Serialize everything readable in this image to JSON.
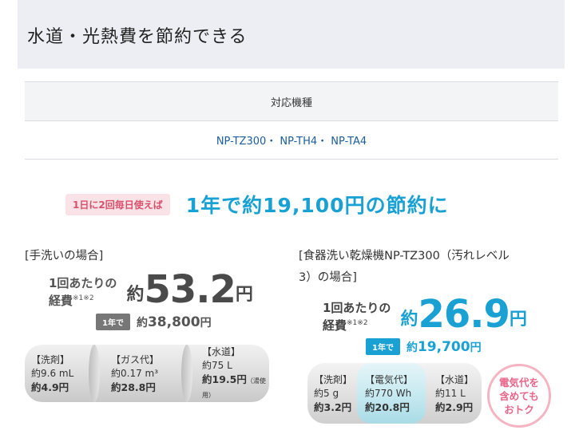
{
  "header": {
    "title": "水道・光熱費を節約できる"
  },
  "models": {
    "header": "対応機種",
    "value": "NP-TZ300・ NP-TH4・ NP-TA4"
  },
  "summary": {
    "tag": "1日に2回毎日使えば",
    "text": "1年で約19,100円の節約に"
  },
  "left": {
    "title": "[手洗いの場合]",
    "perrun_line1": "1回あたりの",
    "perrun_line2": "経費",
    "perrun_note": "※1※2",
    "yaku": "約",
    "amount": "53.2",
    "unit": "円",
    "year_badge": "1年で",
    "year_prefix": "約",
    "year_amount": "38,800",
    "year_unit": "円",
    "items": [
      {
        "label": "【洗剤】",
        "usage": "約9.6 mL",
        "cost": "約4.9円",
        "note": ""
      },
      {
        "label": "【ガス代】",
        "usage": "約0.17 m³",
        "cost": "約28.8円",
        "note": ""
      },
      {
        "label": "【水道】",
        "usage": "約75 L",
        "cost": "約19.5円",
        "note": "（湯使用）"
      }
    ]
  },
  "right": {
    "title_line1": "[食器洗い乾燥機NP-TZ300（汚れレベル",
    "title_line2": "3）の場合]",
    "perrun_line1": "1回あたりの",
    "perrun_line2": "経費",
    "perrun_note": "※1※2",
    "yaku": "約",
    "amount": "26.9",
    "unit": "円",
    "year_badge": "1年で",
    "year_prefix": "約",
    "year_amount": "19,700",
    "year_unit": "円",
    "items": [
      {
        "label": "【洗剤】",
        "usage": "約5 g",
        "cost": "約3.2円"
      },
      {
        "label": "【電気代】",
        "usage": "約770 Wh",
        "cost": "約20.8円"
      },
      {
        "label": "【水道】",
        "usage": "約11 L",
        "cost": "約2.9円"
      }
    ],
    "badge_line1": "電気代を",
    "badge_line2": "含めても",
    "badge_line3": "おトク"
  },
  "colors": {
    "accent": "#1aa1d4",
    "pink": "#e7668a",
    "link": "#1a5d9c"
  }
}
